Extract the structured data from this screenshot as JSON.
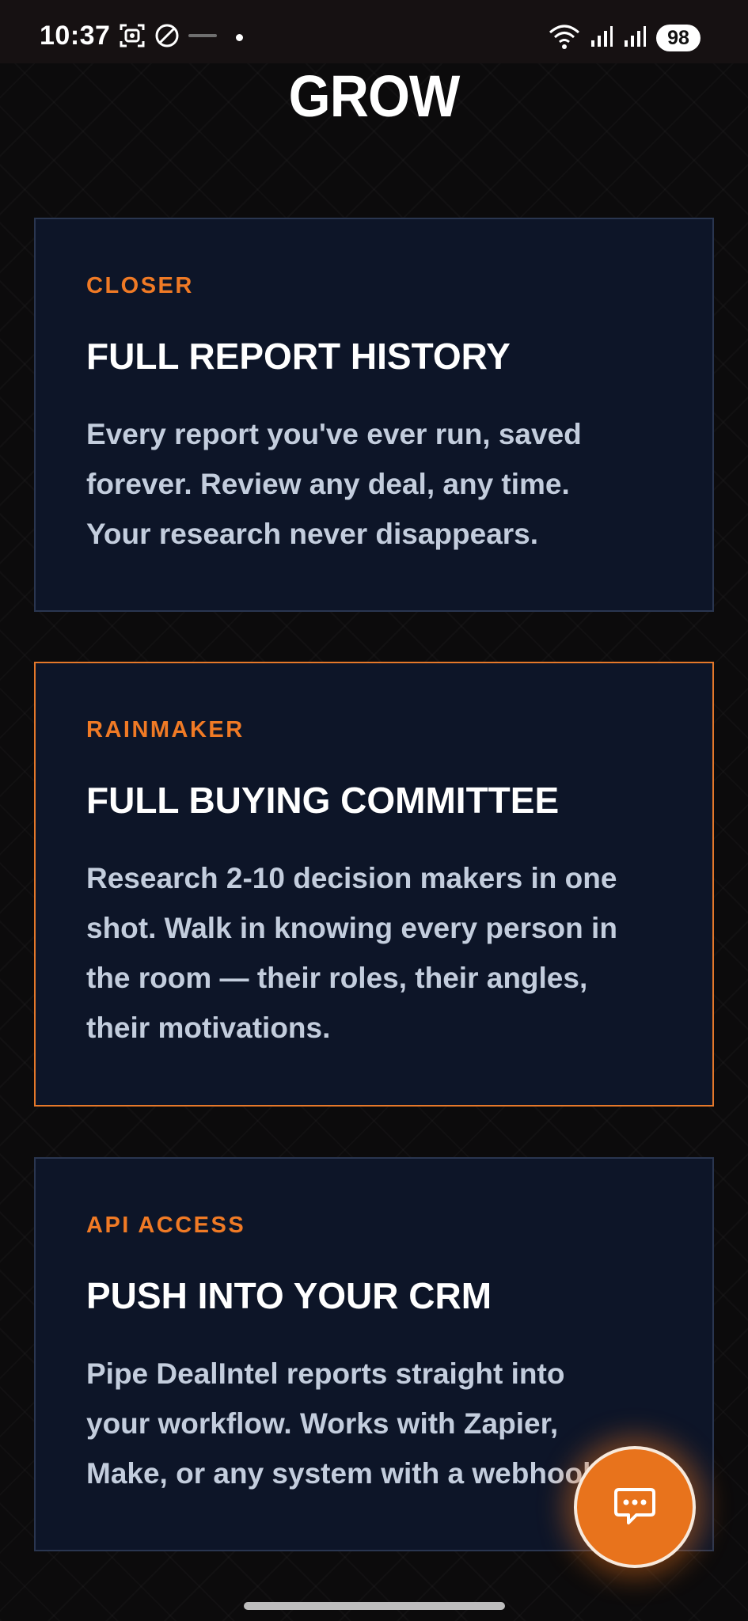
{
  "status_bar": {
    "time": "10:37",
    "battery": "98",
    "left_icons": [
      "screenshot-icon",
      "do-not-disturb-icon",
      "notification-dot-icon"
    ],
    "right_icons": [
      "wifi-icon",
      "signal-icon",
      "signal-icon"
    ]
  },
  "page": {
    "heading": "GROW"
  },
  "cards": [
    {
      "tag": "CLOSER",
      "title": "FULL REPORT HISTORY",
      "lines": [
        "Every report you've ever run, saved",
        "forever. Review any deal, any time.",
        "Your research never disappears."
      ]
    },
    {
      "tag": "RAINMAKER",
      "title": "FULL BUYING COMMITTEE",
      "lines": [
        "Research 2-10 decision makers in one",
        "shot. Walk in knowing every person in",
        "the room — their roles, their angles,",
        "their motivations."
      ]
    },
    {
      "tag": "API ACCESS",
      "title": "PUSH INTO YOUR CRM",
      "lines": [
        "Pipe DealIntel reports straight into",
        "your workflow. Works with Zapier,",
        "Make, or any system with a webhook."
      ]
    }
  ],
  "colors": {
    "accent": "#f07a25",
    "card_bg": "#0d1528",
    "card_border": "#2a3650",
    "highlight_border": "#e5782a",
    "body_text": "#c3cddd"
  },
  "chat_button": {
    "icon": "chat-icon"
  }
}
